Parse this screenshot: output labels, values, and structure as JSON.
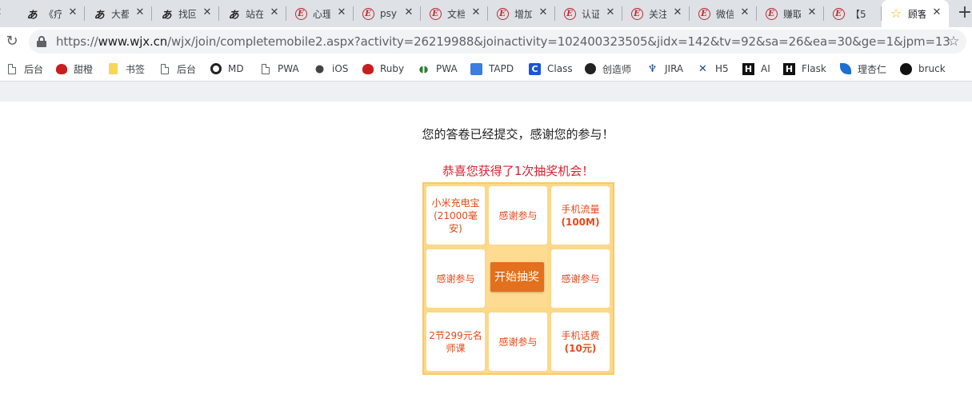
{
  "tabs": [
    {
      "title": "[ ",
      "icon": "brush-icon"
    },
    {
      "title": "《疗",
      "icon": "brush-icon"
    },
    {
      "title": "大都",
      "icon": "brush-icon"
    },
    {
      "title": "找回",
      "icon": "brush-icon"
    },
    {
      "title": "站在",
      "icon": "brush-icon"
    },
    {
      "title": "心理",
      "icon": "e-icon"
    },
    {
      "title": "psy",
      "icon": "e-icon"
    },
    {
      "title": "文档",
      "icon": "e-icon"
    },
    {
      "title": "增加",
      "icon": "e-icon"
    },
    {
      "title": "认证",
      "icon": "e-icon"
    },
    {
      "title": "关注",
      "icon": "e-icon"
    },
    {
      "title": "微信",
      "icon": "e-icon"
    },
    {
      "title": "赚取",
      "icon": "e-icon"
    },
    {
      "title": "【5",
      "icon": "e-icon"
    },
    {
      "title": "顾客",
      "icon": "star-icon",
      "active": true
    }
  ],
  "omnibox": {
    "scheme": "https://",
    "host": "www.wjx.cn",
    "path": "/wjx/join/completemobile2.aspx?activity=26219988&joinactivity=102400323505&jidx=142&tv=92&sa=26&ea=30&ge=1&jpm=13"
  },
  "bookmarks": [
    {
      "label": "后台",
      "icon": "page-icon"
    },
    {
      "label": "甜橙",
      "icon": "weibo-icon"
    },
    {
      "label": "书签",
      "icon": "folder-icon"
    },
    {
      "label": "后台",
      "icon": "page-icon"
    },
    {
      "label": "MD",
      "icon": "lifebuoy-icon"
    },
    {
      "label": "PWA",
      "icon": "page-icon"
    },
    {
      "label": "iOS",
      "icon": "apple-icon"
    },
    {
      "label": "Ruby",
      "icon": "ruby-icon"
    },
    {
      "label": "PWA",
      "icon": "pwa-icon"
    },
    {
      "label": "TAPD",
      "icon": "tapd-icon"
    },
    {
      "label": "Class",
      "icon": "class-icon"
    },
    {
      "label": "创造师",
      "icon": "creator-icon"
    },
    {
      "label": "JIRA",
      "icon": "jira-icon"
    },
    {
      "label": "H5",
      "icon": "h5-icon"
    },
    {
      "label": "AI",
      "icon": "h-icon"
    },
    {
      "label": "Flask",
      "icon": "h-icon"
    },
    {
      "label": "理杏仁",
      "icon": "leaf-icon"
    },
    {
      "label": "bruck",
      "icon": "github-icon"
    }
  ],
  "page": {
    "thanks": "您的答卷已经提交，感谢您的参与！",
    "congrats": "恭喜您获得了1次抽奖机会！",
    "start_button": "开始抽奖"
  },
  "prizes": [
    {
      "line1": "小米充电宝",
      "line2": "(21000毫安)",
      "bold": false
    },
    {
      "line1": "感谢参与",
      "line2": "",
      "bold": false
    },
    {
      "line1": "手机流量",
      "line2": "(100M)",
      "bold": true
    },
    {
      "line1": "感谢参与",
      "line2": "",
      "bold": false
    },
    {
      "line1": "感谢参与",
      "line2": "",
      "bold": false
    },
    {
      "line1": "2节299元名",
      "line2": "师课",
      "bold": false
    },
    {
      "line1": "感谢参与",
      "line2": "",
      "bold": false
    },
    {
      "line1": "手机话费",
      "line2": "(10元)",
      "bold": true
    }
  ],
  "colors": {
    "prize_text": "#e4491a",
    "congrats_text": "#d9212f",
    "board_bg": "#fcd98a",
    "start_button": "#e2701c"
  }
}
